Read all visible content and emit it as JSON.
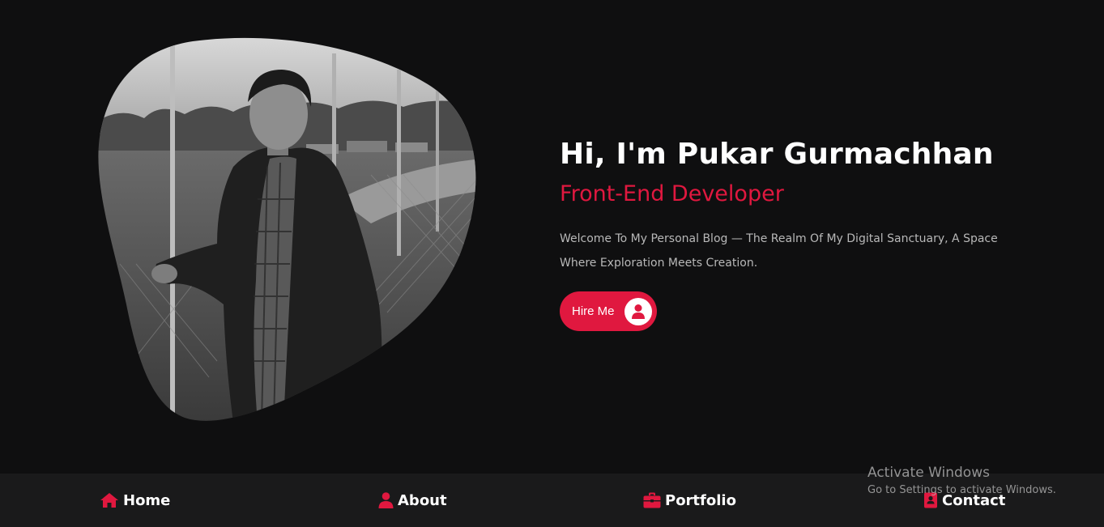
{
  "hero": {
    "title": "Hi, I'm Pukar Gurmachhan",
    "role": "Front-End Developer",
    "description": "Welcome To My Personal Blog — The Realm Of My Digital Sanctuary, A Space Where Exploration Meets Creation.",
    "hire_label": "Hire Me",
    "hire_icon": "user-icon"
  },
  "nav": {
    "items": [
      {
        "label": "Home",
        "icon": "home-icon"
      },
      {
        "label": "About",
        "icon": "user-icon"
      },
      {
        "label": "Portfolio",
        "icon": "briefcase-icon"
      },
      {
        "label": "Contact",
        "icon": "address-book-icon"
      }
    ]
  },
  "watermark": {
    "title": "Activate Windows",
    "subtitle": "Go to Settings to activate Windows."
  },
  "colors": {
    "background": "#0f0f10",
    "accent": "#e0183f",
    "nav_background": "#1a1a1b"
  }
}
